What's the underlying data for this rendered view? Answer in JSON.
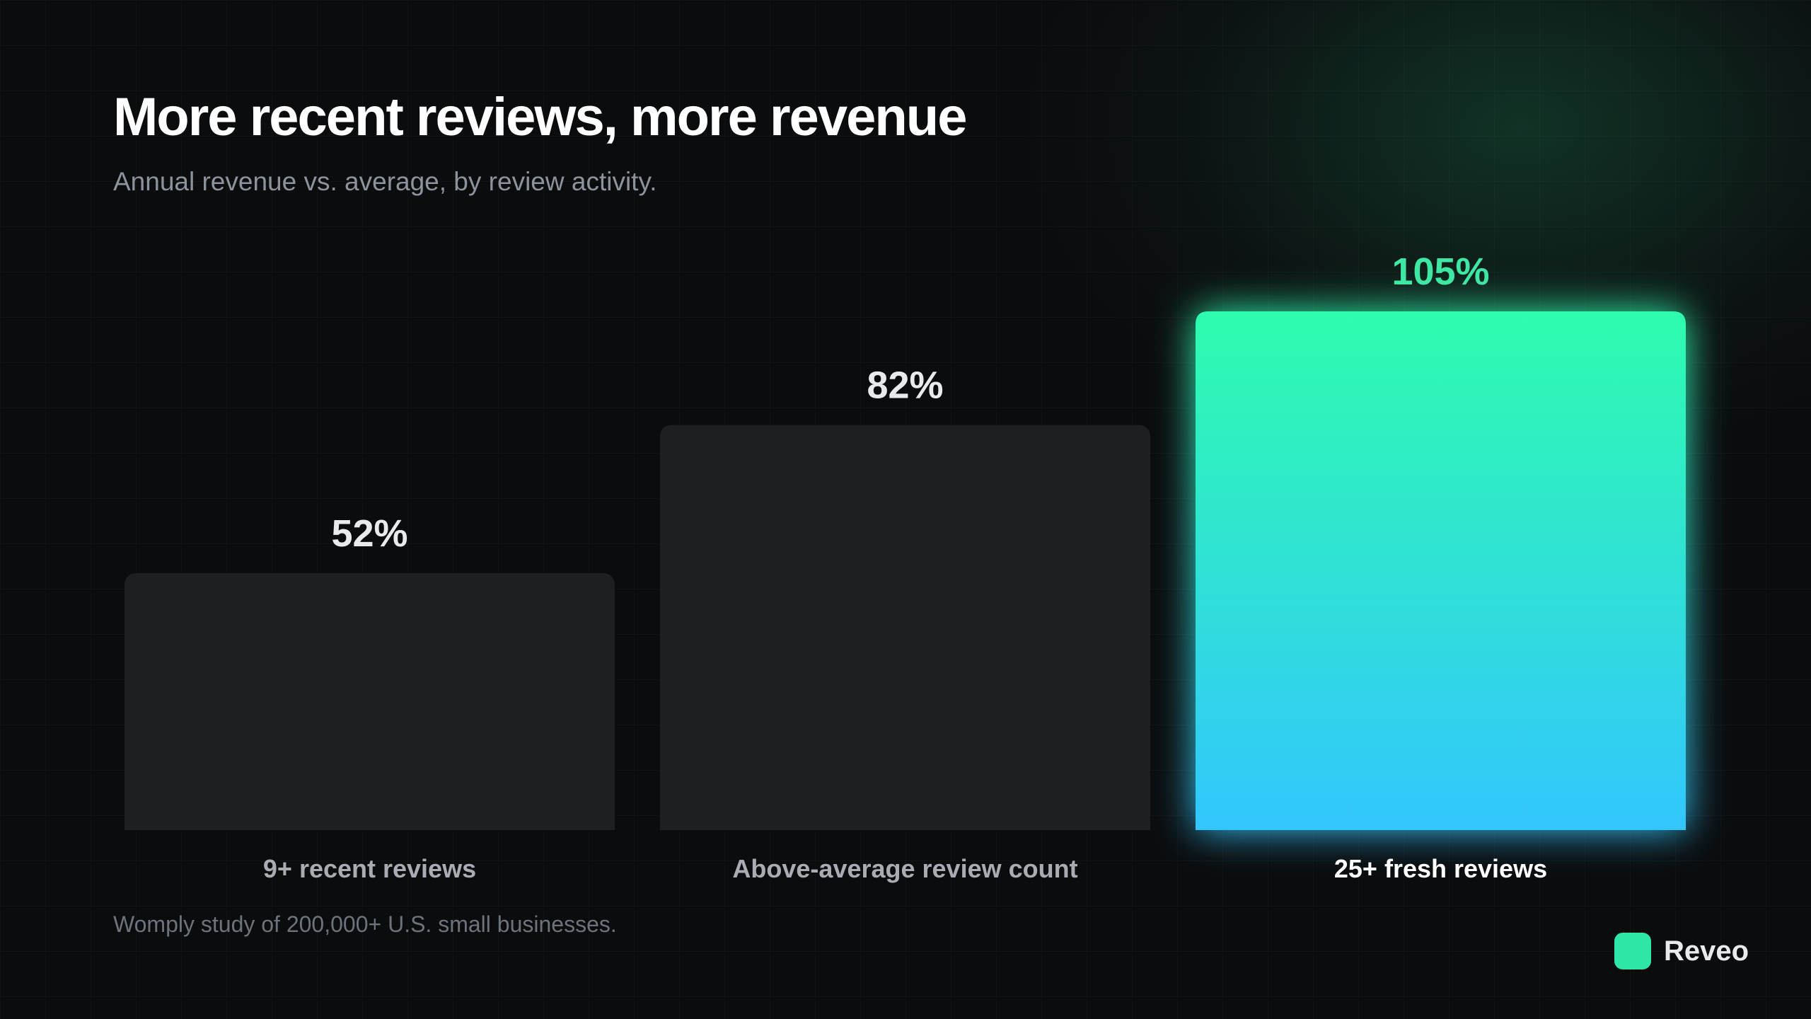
{
  "header": {
    "title": "More recent reviews, more revenue",
    "subtitle": "Annual revenue vs. average, by review activity."
  },
  "footnote": "Womply study of 200,000+ U.S. small businesses.",
  "brand": {
    "name": "Reveo",
    "color": "#2ee6a6"
  },
  "colors": {
    "bar_default": "#1e1f22",
    "bar_highlight_top": "#2ffcae",
    "bar_highlight_bottom": "#30c6fd",
    "value_default": "#e9eaec",
    "value_highlight": "#3ee8a4",
    "label_default": "#a9adb3",
    "label_highlight": "#ffffff"
  },
  "chart_data": {
    "type": "bar",
    "title": "More recent reviews, more revenue",
    "subtitle": "Annual revenue vs. average, by review activity.",
    "categories": [
      "9+ recent reviews",
      "Above-average review count",
      "25+ fresh reviews"
    ],
    "values": [
      52,
      82,
      105
    ],
    "value_labels": [
      "52%",
      "82%",
      "105%"
    ],
    "highlight_index": 2,
    "xlabel": "",
    "ylabel": "",
    "ylim": [
      0,
      105
    ],
    "grid": false,
    "legend": "none"
  }
}
